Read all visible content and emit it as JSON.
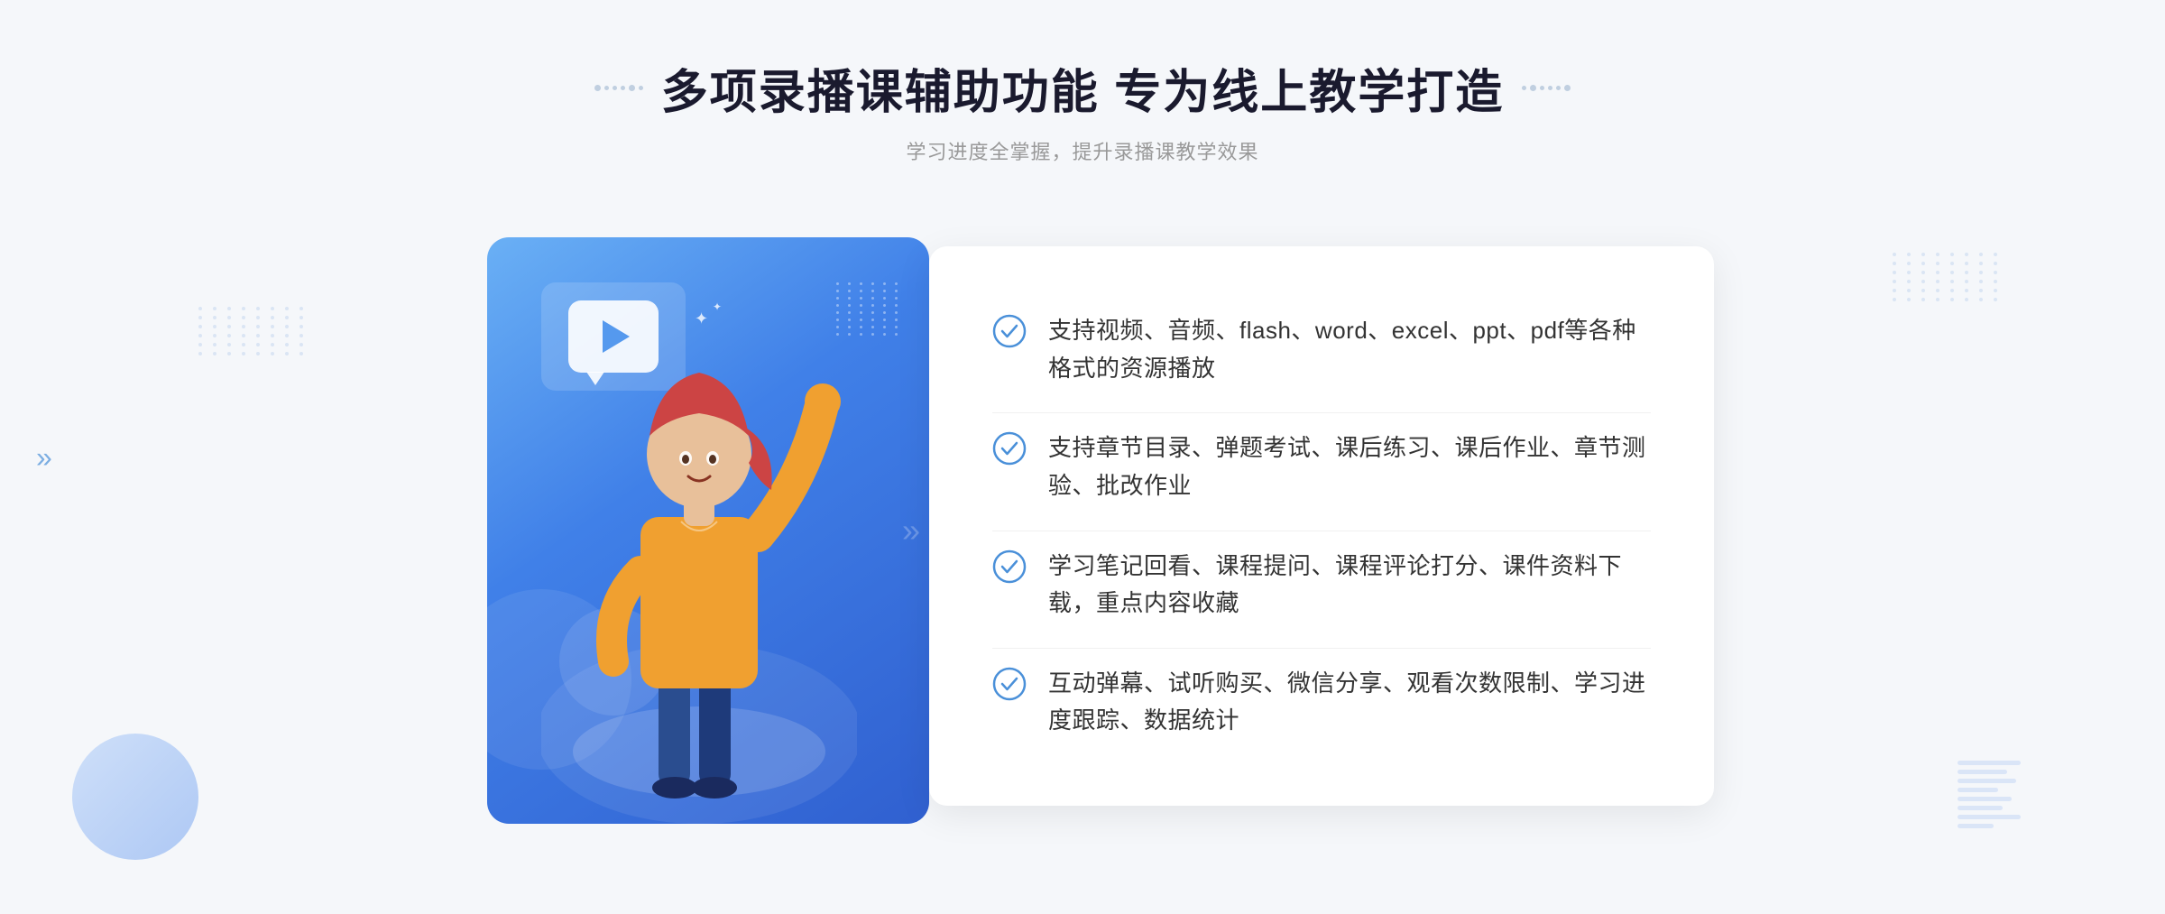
{
  "header": {
    "main_title": "多项录播课辅助功能 专为线上教学打造",
    "subtitle": "学习进度全掌握，提升录播课教学效果"
  },
  "features": [
    {
      "id": "feature-1",
      "text": "支持视频、音频、flash、word、excel、ppt、pdf等各种格式的资源播放"
    },
    {
      "id": "feature-2",
      "text": "支持章节目录、弹题考试、课后练习、课后作业、章节测验、批改作业"
    },
    {
      "id": "feature-3",
      "text": "学习笔记回看、课程提问、课程评论打分、课件资料下载，重点内容收藏"
    },
    {
      "id": "feature-4",
      "text": "互动弹幕、试听购买、微信分享、观看次数限制、学习进度跟踪、数据统计"
    }
  ]
}
